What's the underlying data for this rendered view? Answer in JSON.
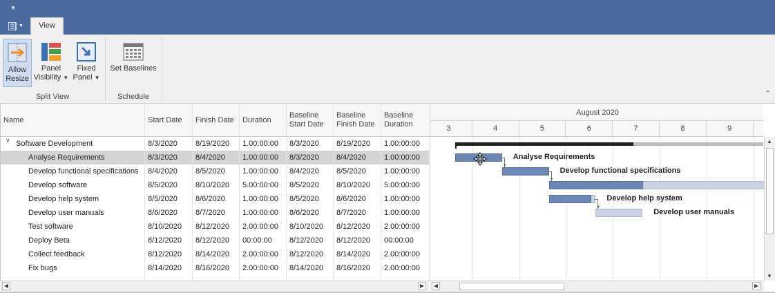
{
  "tabs": [
    {
      "label": "View"
    }
  ],
  "ribbon": {
    "allow_resize": {
      "line1": "Allow",
      "line2": "Resize"
    },
    "panel_visibility": {
      "line1": "Panel",
      "line2": "Visibility"
    },
    "fixed_panel": {
      "line1": "Fixed",
      "line2": "Panel"
    },
    "set_baselines": {
      "label": "Set Baselines"
    },
    "groups": {
      "split_view": "Split View",
      "schedule": "Schedule"
    }
  },
  "grid": {
    "columns": [
      {
        "line1": "Name",
        "line2": ""
      },
      {
        "line1": "Start Date",
        "line2": ""
      },
      {
        "line1": "Finish Date",
        "line2": ""
      },
      {
        "line1": "Duration",
        "line2": ""
      },
      {
        "line1": "Baseline",
        "line2": "Start Date"
      },
      {
        "line1": "Baseline",
        "line2": "Finish Date"
      },
      {
        "line1": "Baseline",
        "line2": "Duration"
      }
    ],
    "rows": [
      {
        "name": "Software Development",
        "start": "8/3/2020",
        "finish": "8/19/2020",
        "duration": "1.00:00:00",
        "b_start": "8/3/2020",
        "b_finish": "8/19/2020",
        "b_duration": "1.00:00:00"
      },
      {
        "name": "Analyse Requirements",
        "start": "8/3/2020",
        "finish": "8/4/2020",
        "duration": "1.00:00:00",
        "b_start": "8/3/2020",
        "b_finish": "8/4/2020",
        "b_duration": "1.00:00:00"
      },
      {
        "name": "Develop functional specifications",
        "start": "8/4/2020",
        "finish": "8/5/2020",
        "duration": "1.00:00:00",
        "b_start": "8/4/2020",
        "b_finish": "8/5/2020",
        "b_duration": "1.00:00:00"
      },
      {
        "name": "Develop software",
        "start": "8/5/2020",
        "finish": "8/10/2020",
        "duration": "5.00:00:00",
        "b_start": "8/5/2020",
        "b_finish": "8/10/2020",
        "b_duration": "5.00:00:00"
      },
      {
        "name": "Develop help system",
        "start": "8/5/2020",
        "finish": "8/6/2020",
        "duration": "1.00:00:00",
        "b_start": "8/5/2020",
        "b_finish": "8/6/2020",
        "b_duration": "1.00:00:00"
      },
      {
        "name": "Develop user manuals",
        "start": "8/6/2020",
        "finish": "8/7/2020",
        "duration": "1.00:00:00",
        "b_start": "8/6/2020",
        "b_finish": "8/7/2020",
        "b_duration": "1.00:00:00"
      },
      {
        "name": "Test software",
        "start": "8/10/2020",
        "finish": "8/12/2020",
        "duration": "2.00:00:00",
        "b_start": "8/10/2020",
        "b_finish": "8/12/2020",
        "b_duration": "2.00:00:00"
      },
      {
        "name": "Deploy Beta",
        "start": "8/12/2020",
        "finish": "8/12/2020",
        "duration": "00:00:00",
        "b_start": "8/12/2020",
        "b_finish": "8/12/2020",
        "b_duration": "00:00:00"
      },
      {
        "name": "Collect feedback",
        "start": "8/12/2020",
        "finish": "8/14/2020",
        "duration": "2.00:00:00",
        "b_start": "8/12/2020",
        "b_finish": "8/14/2020",
        "b_duration": "2.00:00:00"
      },
      {
        "name": "Fix bugs",
        "start": "8/14/2020",
        "finish": "8/16/2020",
        "duration": "2.00:00:00",
        "b_start": "8/14/2020",
        "b_finish": "8/16/2020",
        "b_duration": "2.00:00:00"
      }
    ]
  },
  "gantt": {
    "month": "August 2020",
    "days": [
      "3",
      "4",
      "5",
      "6",
      "7",
      "8",
      "9"
    ],
    "task_labels": [
      "Analyse Requirements",
      "Develop functional specifications",
      "Develop help system",
      "Develop user manuals"
    ],
    "progress": {
      "summary": 0.58,
      "develop_software": 0.4,
      "develop_help_system": 0.9
    }
  },
  "colors": {
    "title_bar": "#4a6aa0",
    "task_bar": "#6c87b3",
    "baseline_bar": "#c9d3e3",
    "selected_row": "#d4d4d4"
  }
}
